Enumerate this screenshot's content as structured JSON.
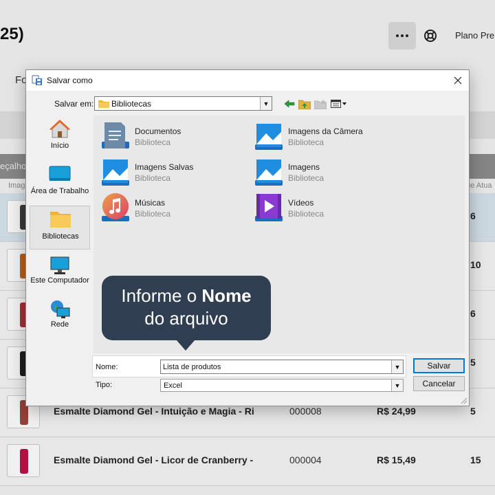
{
  "background": {
    "page_title": "25)",
    "plan_label": "Plano Pre",
    "filter_label": "Fo",
    "header_left": "eçalho",
    "subheader_left": "Imag",
    "subheader_right": "que Atua",
    "rows": [
      {
        "name": "",
        "code": "",
        "price": "",
        "stock": "6",
        "selected": true,
        "color": "#3d3d3d"
      },
      {
        "name": "",
        "code": "",
        "price": "",
        "stock": "10",
        "selected": false,
        "color": "#c0641c"
      },
      {
        "name": "",
        "code": "",
        "price": "",
        "stock": "6",
        "selected": false,
        "color": "#b0303a"
      },
      {
        "name": "",
        "code": "",
        "price": "",
        "stock": "5",
        "selected": false,
        "color": "#202020"
      },
      {
        "name": "Esmalte Diamond Gel - Intuição e Magia - Ri",
        "code": "000008",
        "price": "R$ 24,99",
        "stock": "5",
        "selected": false,
        "color": "#a0443c"
      },
      {
        "name": "Esmalte Diamond Gel - Licor de Cranberry -",
        "code": "000004",
        "price": "R$ 15,49",
        "stock": "15",
        "selected": false,
        "color": "#c01044"
      }
    ]
  },
  "dialog": {
    "title": "Salvar como",
    "save_in_label": "Salvar em:",
    "save_in_value": "Bibliotecas",
    "places": [
      {
        "label": "Início",
        "icon": "home-icon"
      },
      {
        "label": "Área de Trabalho",
        "icon": "desktop-icon"
      },
      {
        "label": "Bibliotecas",
        "icon": "libraries-icon"
      },
      {
        "label": "Este Computador",
        "icon": "computer-icon"
      },
      {
        "label": "Rede",
        "icon": "network-icon"
      }
    ],
    "files": [
      {
        "name": "Documentos",
        "type": "Biblioteca",
        "icon": "documents-library-icon"
      },
      {
        "name": "Imagens da Câmera",
        "type": "Biblioteca",
        "icon": "camera-roll-library-icon"
      },
      {
        "name": "Imagens Salvas",
        "type": "Biblioteca",
        "icon": "saved-pictures-library-icon"
      },
      {
        "name": "Imagens",
        "type": "Biblioteca",
        "icon": "pictures-library-icon"
      },
      {
        "name": "Músicas",
        "type": "Biblioteca",
        "icon": "music-library-icon"
      },
      {
        "name": "Vídeos",
        "type": "Biblioteca",
        "icon": "videos-library-icon"
      }
    ],
    "name_label": "Nome:",
    "name_value": "Lista de produtos",
    "type_label": "Tipo:",
    "type_value": "Excel",
    "save_button": "Salvar",
    "cancel_button": "Cancelar"
  },
  "tooltip": {
    "line1_prefix": "Informe o ",
    "line1_bold": "Nome",
    "line2": "do arquivo",
    "color": "#2f3e50"
  }
}
